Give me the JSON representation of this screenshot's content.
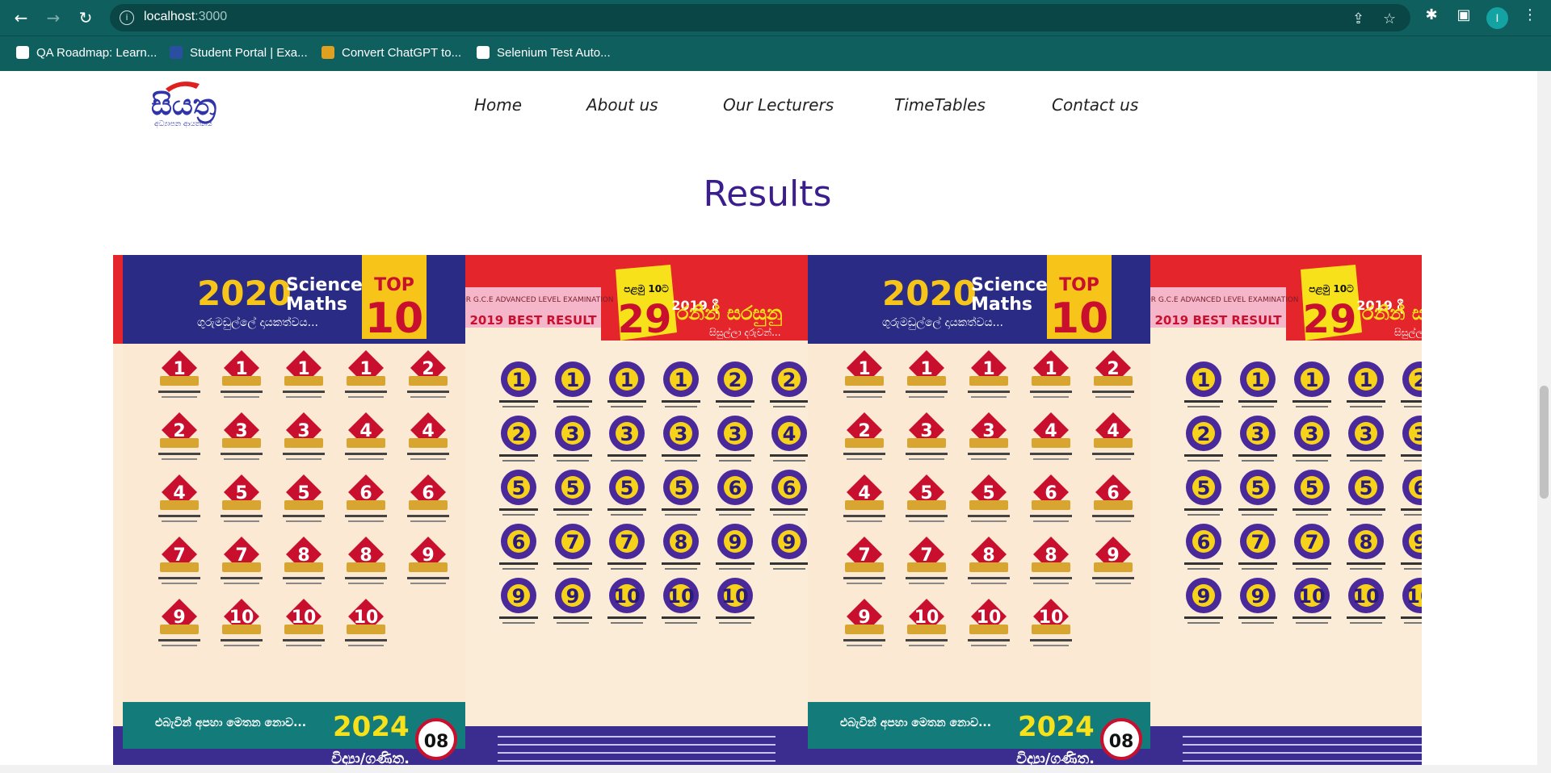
{
  "browser": {
    "url_host": "localhost",
    "url_port": ":3000",
    "profile_initial": "I",
    "bookmarks": [
      {
        "label": "QA Roadmap: Learn...",
        "icon": "roadmap-favicon"
      },
      {
        "label": "Student Portal | Exa...",
        "icon": "student-portal-favicon"
      },
      {
        "label": "Convert ChatGPT to...",
        "icon": "convert-favicon"
      },
      {
        "label": "Selenium Test Auto...",
        "icon": "medium-favicon"
      }
    ]
  },
  "site": {
    "logo_text": "සියත්‍ර",
    "logo_subtitle": "අධ්‍යාපන ආයතනය",
    "nav": [
      "Home",
      "About us",
      "Our Lecturers",
      "TimeTables",
      "Contact us"
    ]
  },
  "results": {
    "heading": "Results",
    "poster_a": {
      "year": "2020",
      "subject_line1": "Science",
      "subject_line2": "Maths",
      "tagline": "ගුරුමඩුල්ලේ දායකත්වය...",
      "badge_top": "TOP",
      "badge_num": "10",
      "ranks": [
        "1",
        "1",
        "1",
        "1",
        "2",
        "2",
        "3",
        "3",
        "4",
        "4",
        "4",
        "5",
        "5",
        "6",
        "6",
        "7",
        "7",
        "8",
        "8",
        "9",
        "9",
        "10",
        "10",
        "10"
      ],
      "footer_year": "2024",
      "footer_text": "විද්‍යා/ගණිත.",
      "footer_num": "08",
      "footer_left": "එබැවින් අපහා මෙතන නොව..."
    },
    "poster_b": {
      "subtitle_small": "FOR G.C.E ADVANCED LEVEL EXAMINATION",
      "best_result": "2019 BEST RESULT",
      "badge_top": "පළමු 10ට",
      "badge_num": "29",
      "badge_suffix": "ක්",
      "year_label": "2019 දී",
      "title": "රනින් සරසුනු",
      "title_sub": "සිසුල්ලා දරුවන්...",
      "ranks": [
        "1",
        "1",
        "1",
        "1",
        "2",
        "2",
        "2",
        "3",
        "3",
        "3",
        "3",
        "4",
        "5",
        "5",
        "5",
        "5",
        "6",
        "6",
        "6",
        "7",
        "7",
        "8",
        "9",
        "9",
        "9",
        "9",
        "10",
        "10",
        "10"
      ]
    }
  }
}
